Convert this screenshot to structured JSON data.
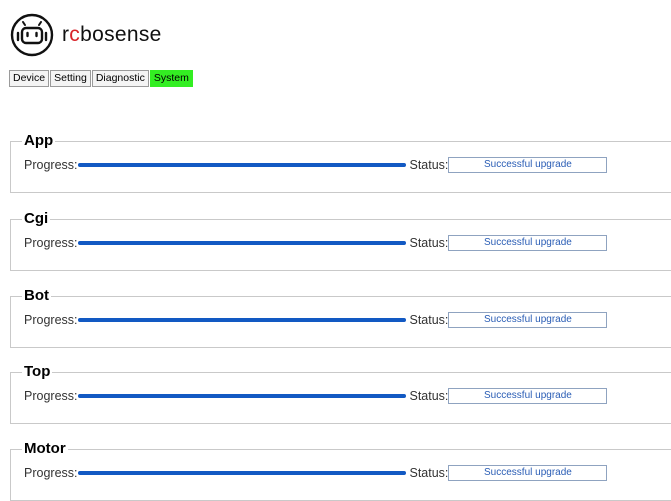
{
  "brand": {
    "name_prefix": "r",
    "name_accent": "c",
    "name_suffix": "bosense"
  },
  "tabs": [
    {
      "label": "Device",
      "active": false
    },
    {
      "label": "Setting",
      "active": false
    },
    {
      "label": "Diagnostic",
      "active": false
    },
    {
      "label": "System",
      "active": true
    }
  ],
  "labels": {
    "progress": "Progress:",
    "status": "Status:"
  },
  "sections": [
    {
      "title": "App",
      "progress": 1.0,
      "status": "Successful upgrade"
    },
    {
      "title": "Cgi",
      "progress": 1.0,
      "status": "Successful upgrade"
    },
    {
      "title": "Bot",
      "progress": 1.0,
      "status": "Successful upgrade"
    },
    {
      "title": "Top",
      "progress": 1.0,
      "status": "Successful upgrade"
    },
    {
      "title": "Motor",
      "progress": 1.0,
      "status": "Successful upgrade"
    }
  ],
  "colors": {
    "active_tab": "#33ee22",
    "progress": "#1259c3",
    "brand_accent": "#d8232a"
  },
  "icons": {
    "logo": "robot-head-icon"
  }
}
